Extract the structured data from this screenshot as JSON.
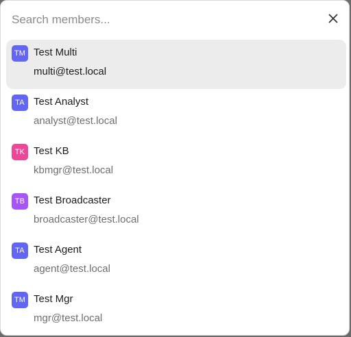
{
  "search": {
    "placeholder": "Search members...",
    "value": ""
  },
  "close_icon": "close-icon",
  "members": [
    {
      "initials": "TM",
      "name": "Test Multi",
      "email": "multi@test.local",
      "color": "#6366f1",
      "selected": true
    },
    {
      "initials": "TA",
      "name": "Test Analyst",
      "email": "analyst@test.local",
      "color": "#6366f1",
      "selected": false
    },
    {
      "initials": "TK",
      "name": "Test KB",
      "email": "kbmgr@test.local",
      "color": "#ec4899",
      "selected": false
    },
    {
      "initials": "TB",
      "name": "Test Broadcaster",
      "email": "broadcaster@test.local",
      "color": "#a855f7",
      "selected": false
    },
    {
      "initials": "TA",
      "name": "Test Agent",
      "email": "agent@test.local",
      "color": "#6366f1",
      "selected": false
    },
    {
      "initials": "TM",
      "name": "Test Mgr",
      "email": "mgr@test.local",
      "color": "#6366f1",
      "selected": false
    }
  ]
}
